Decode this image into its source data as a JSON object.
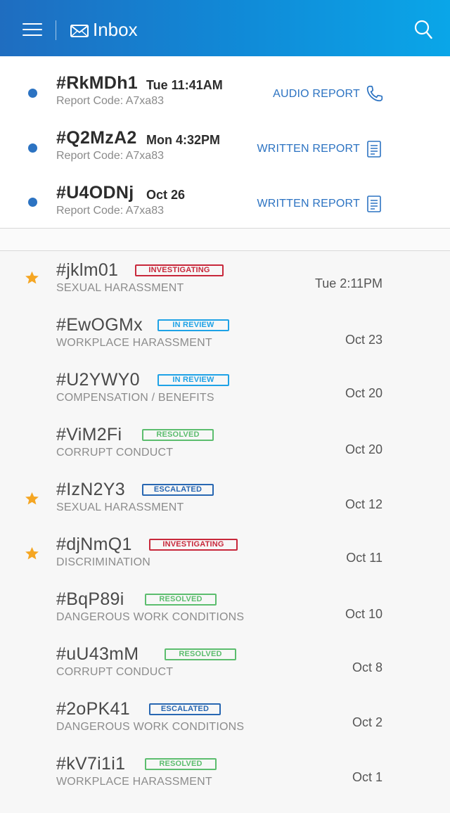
{
  "header": {
    "title": "Inbox",
    "menu_icon": "hamburger-menu-icon",
    "mail_icon": "envelope-icon",
    "search_icon": "search-icon",
    "gradient_start": "#1f6dc0",
    "gradient_end": "#0aa6e8"
  },
  "unread": [
    {
      "id": "#RkMDh1",
      "time": "Tue 11:41AM",
      "code": "Report Code: A7xa83",
      "type": "AUDIO REPORT",
      "icon": "phone-icon"
    },
    {
      "id": "#Q2MzA2",
      "time": "Mon 4:32PM",
      "code": "Report Code: A7xa83",
      "type": "WRITTEN REPORT",
      "icon": "document-icon"
    },
    {
      "id": "#U4ODNj",
      "time": "Oct 26",
      "code": "Report Code: A7xa83",
      "type": "WRITTEN REPORT",
      "icon": "document-icon"
    }
  ],
  "cases": [
    {
      "id": "#jklm01",
      "status": "INVESTIGATING",
      "category": "SEXUAL HARASSMENT",
      "date": "Tue 2:11PM",
      "starred": true
    },
    {
      "id": "#EwOGMx",
      "status": "IN REVIEW",
      "category": "WORKPLACE HARASSMENT",
      "date": "Oct 23",
      "starred": false
    },
    {
      "id": "#U2YWY0",
      "status": "IN REVIEW",
      "category": "COMPENSATION / BENEFITS",
      "date": "Oct 20",
      "starred": false
    },
    {
      "id": "#ViM2Fi",
      "status": "RESOLVED",
      "category": "CORRUPT CONDUCT",
      "date": "Oct 20",
      "starred": false
    },
    {
      "id": "#IzN2Y3",
      "status": "ESCALATED",
      "category": "SEXUAL HARASSMENT",
      "date": "Oct 12",
      "starred": true
    },
    {
      "id": "#djNmQ1",
      "status": "INVESTIGATING",
      "category": "DISCRIMINATION",
      "date": "Oct 11",
      "starred": true
    },
    {
      "id": "#BqP89i",
      "status": "RESOLVED",
      "category": "DANGEROUS WORK CONDITIONS",
      "date": "Oct 10",
      "starred": false
    },
    {
      "id": "#uU43mM",
      "status": "RESOLVED",
      "category": "CORRUPT CONDUCT",
      "date": "Oct 8",
      "starred": false
    },
    {
      "id": "#2oPK41",
      "status": "ESCALATED",
      "category": "DANGEROUS WORK CONDITIONS",
      "date": "Oct 2",
      "starred": false
    },
    {
      "id": "#kV7i1i1",
      "status": "RESOLVED",
      "category": "WORKPLACE HARASSMENT",
      "date": "Oct 1",
      "starred": false
    }
  ],
  "colors": {
    "accent": "#2c73c2",
    "investigating": "#c8283b",
    "in_review": "#1ea2e6",
    "resolved": "#5cbd6e",
    "escalated": "#2867b2",
    "star": "#f5a623"
  }
}
